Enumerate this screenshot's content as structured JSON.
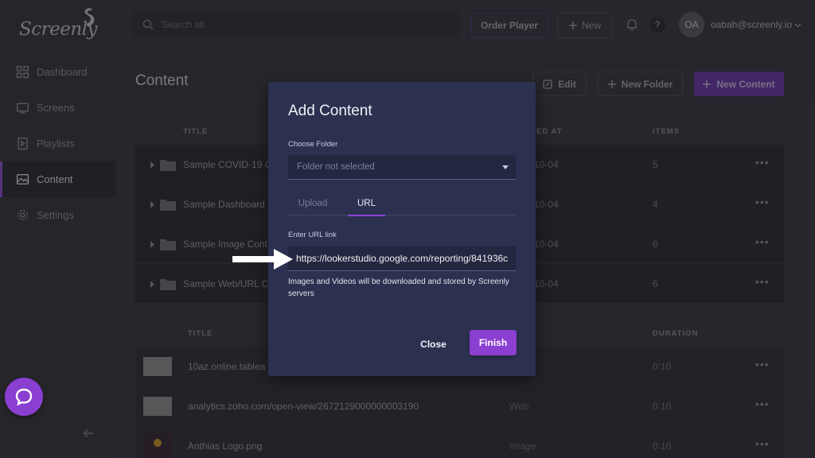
{
  "app": {
    "logo_text": "Screenly",
    "brand_color": "#8a3fd1"
  },
  "sidebar": {
    "items": [
      {
        "label": "Dashboard",
        "icon": "dashboard-icon"
      },
      {
        "label": "Screens",
        "icon": "screen-icon"
      },
      {
        "label": "Playlists",
        "icon": "playlist-icon"
      },
      {
        "label": "Content",
        "icon": "content-icon",
        "active": true
      },
      {
        "label": "Settings",
        "icon": "gear-icon"
      }
    ]
  },
  "topbar": {
    "search_placeholder": "Search all",
    "order_player_label": "Order Player",
    "new_label": "New",
    "help_label": "?",
    "avatar_initials": "OA",
    "user_email": "oabah@screenly.io"
  },
  "page": {
    "title": "Content",
    "edit_label": "Edit",
    "new_folder_label": "New Folder",
    "new_content_label": "New Content"
  },
  "folder_table": {
    "headers": {
      "title": "TITLE",
      "created_at": "ED AT",
      "items": "ITEMS"
    },
    "rows": [
      {
        "name": "Sample COVID-19 C",
        "date": "10-04",
        "items": "5"
      },
      {
        "name": "Sample Dashboard",
        "date": "10-04",
        "items": "4"
      },
      {
        "name": "Sample Image Cont",
        "date": "10-04",
        "items": "6"
      },
      {
        "name": "Sample Web/URL C",
        "date": "10-04",
        "items": "6"
      }
    ]
  },
  "file_table": {
    "headers": {
      "title": "TITLE",
      "duration": "DURATION"
    },
    "rows": [
      {
        "name": "10az.online.tablea",
        "type": "",
        "duration": "0:10"
      },
      {
        "name": "analytics.zoho.com/open-view/2672129000000003190",
        "type": "Web",
        "duration": "0:10"
      },
      {
        "name": "Anthias Logo.png",
        "type": "Image",
        "duration": "0:10"
      }
    ]
  },
  "modal": {
    "title": "Add Content",
    "folder_label": "Choose Folder",
    "folder_placeholder": "Folder not selected",
    "tab_upload": "Upload",
    "tab_url": "URL",
    "url_label": "Enter URL link",
    "url_value": "https://lookerstudio.google.com/reporting/841936c",
    "help_text": "Images and Videos will be downloaded and stored by Screenly servers",
    "close_label": "Close",
    "finish_label": "Finish"
  }
}
